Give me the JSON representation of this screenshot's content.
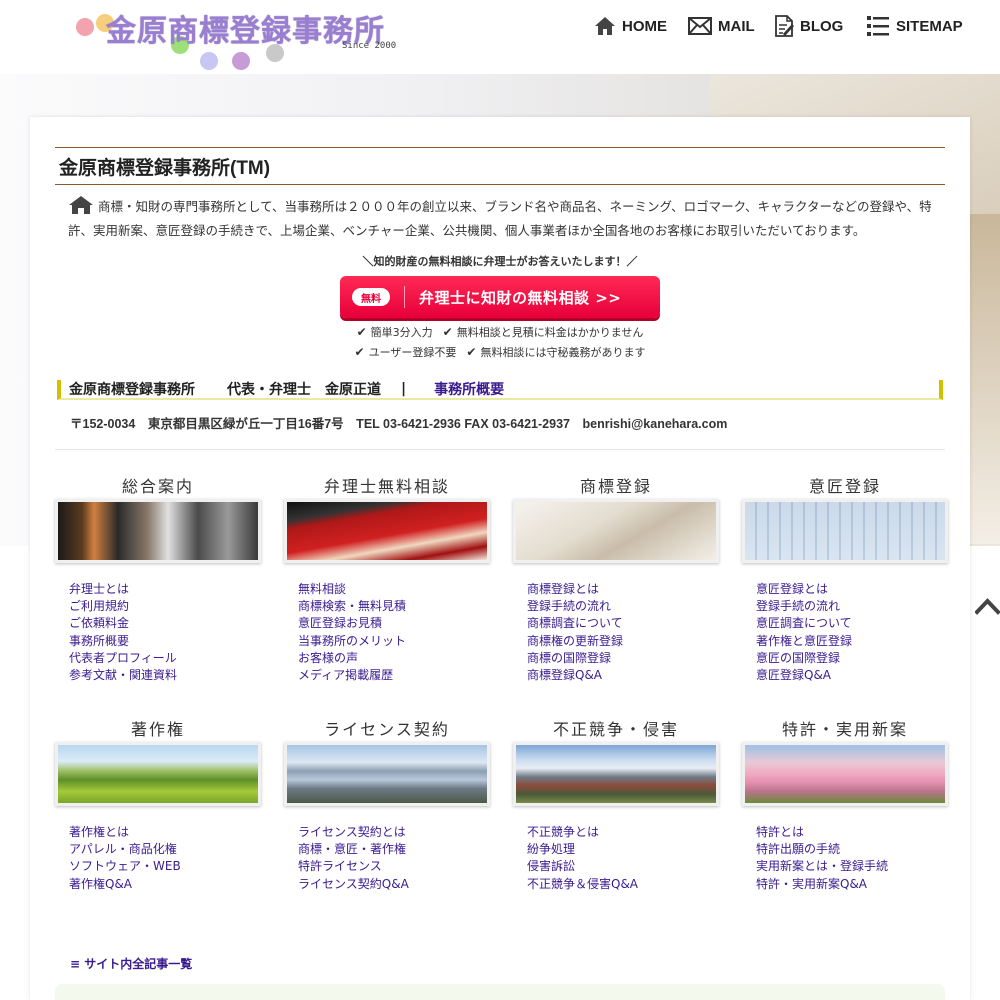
{
  "header": {
    "logo_text": "金原商標登録事務所",
    "logo_since": "Since 2000",
    "logo_dot_colors": [
      "#f3a3ad",
      "#f5cf7c",
      "#9de07a",
      "#c8c6f3",
      "#c79bd6",
      "#c9c9c9"
    ],
    "nav": [
      {
        "label": "HOME",
        "icon": "home-icon"
      },
      {
        "label": "MAIL",
        "icon": "mail-icon"
      },
      {
        "label": "BLOG",
        "icon": "blog-icon"
      },
      {
        "label": "SITEMAP",
        "icon": "list-icon"
      }
    ]
  },
  "main": {
    "title": "金原商標登録事務所(TM)",
    "intro": "商標・知財の専門事務所として、当事務所は２０００年の創立以来、ブランド名や商品名、ネーミング、ロゴマーク、キャラクターなどの登録や、特許、実用新案、意匠登録の手続きで、上場企業、ベンチャー企業、公共機関、個人事業者ほか全国各地のお客様にお取引いただいております。",
    "consult": {
      "headline": "＼知的財産の無料相談に弁理士がお答えいたします！／",
      "badge": "無料",
      "button_label": "弁理士に知財の無料相談 >>",
      "checks_row1": [
        "簡単3分入力",
        "無料相談と見積に料金はかかりません"
      ],
      "checks_row2": [
        "ユーザー登録不要",
        "無料相談には守秘義務があります"
      ]
    },
    "office": {
      "name": "金原商標登録事務所",
      "rep": "代表・弁理士　金原正道",
      "separator": "|",
      "link": "事務所概要",
      "address": "〒152-0034　東京都目黒区緑が丘一丁目16番7号　TEL 03-6421-2936 FAX 03-6421-2937　benrishi@kanehara.com"
    },
    "categories": [
      {
        "title": "総合案内",
        "links": [
          "弁理士とは",
          "ご利用規約",
          "ご依頼料金",
          "事務所概要",
          "代表者プロフィール",
          "参考文献・関連資料"
        ]
      },
      {
        "title": "弁理士無料相談",
        "links": [
          "無料相談",
          "商標検索・無料見積",
          "意匠登録お見積",
          "当事務所のメリット",
          "お客様の声",
          "メディア掲載履歴"
        ]
      },
      {
        "title": "商標登録",
        "links": [
          "商標登録とは",
          "登録手続の流れ",
          "商標調査について",
          "商標権の更新登録",
          "商標の国際登録",
          "商標登録Q&A"
        ]
      },
      {
        "title": "意匠登録",
        "links": [
          "意匠登録とは",
          "登録手続の流れ",
          "意匠調査について",
          "著作権と意匠登録",
          "意匠の国際登録",
          "意匠登録Q&A"
        ]
      },
      {
        "title": "著作権",
        "links": [
          "著作権とは",
          "アパレル・商品化権",
          "ソフトウェア・WEB",
          "著作権Q&A"
        ]
      },
      {
        "title": "ライセンス契約",
        "links": [
          "ライセンス契約とは",
          "商標・意匠・著作権",
          "特許ライセンス",
          "ライセンス契約Q&A"
        ]
      },
      {
        "title": "不正競争・侵害",
        "links": [
          "不正競争とは",
          "紛争処理",
          "侵害訴訟",
          "不正競争＆侵害Q&A"
        ]
      },
      {
        "title": "特許・実用新案",
        "links": [
          "特許とは",
          "特許出願の手続",
          "実用新案とは・登録手続",
          "特許・実用新案Q&A"
        ]
      }
    ],
    "all_articles": "≡ サイト内全記事一覧"
  }
}
